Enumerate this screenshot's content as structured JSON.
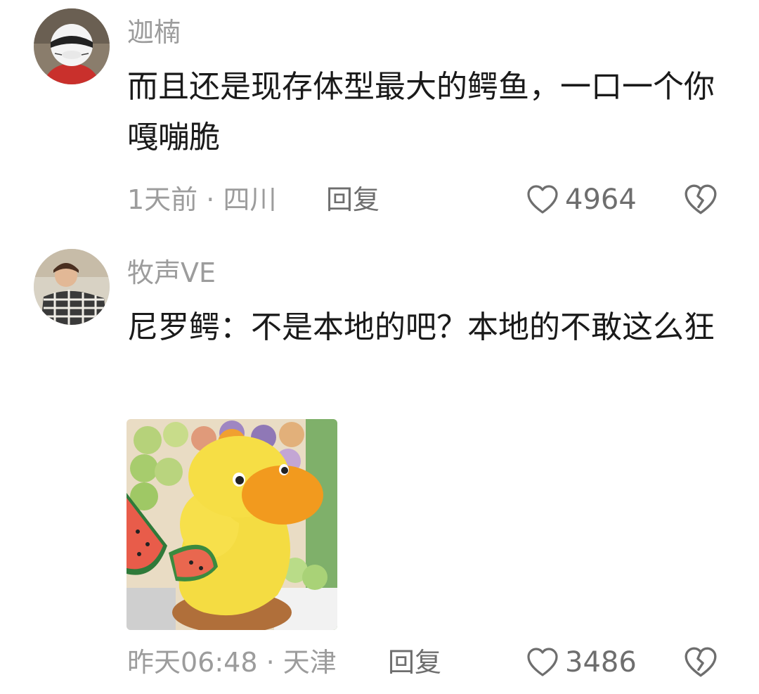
{
  "comments": [
    {
      "username": "迦楠",
      "body": "而且还是现存体型最大的鳄鱼，一口一个你嘎嘣脆",
      "time": "1天前",
      "location": "四川",
      "reply_label": "回复",
      "likes": "4964"
    },
    {
      "username": "牧声VE",
      "body": "尼罗鳄：不是本地的吧？本地的不敢这么狂",
      "time": "昨天06:48",
      "location": "天津",
      "reply_label": "回复",
      "likes": "3486"
    }
  ],
  "meta_separator": "·",
  "icons": {
    "like": "heart-outline-icon",
    "dislike": "broken-heart-icon"
  },
  "colors": {
    "text_primary": "#1a1a1a",
    "text_secondary": "#9c9c9c",
    "icon": "#6e6e6e"
  }
}
